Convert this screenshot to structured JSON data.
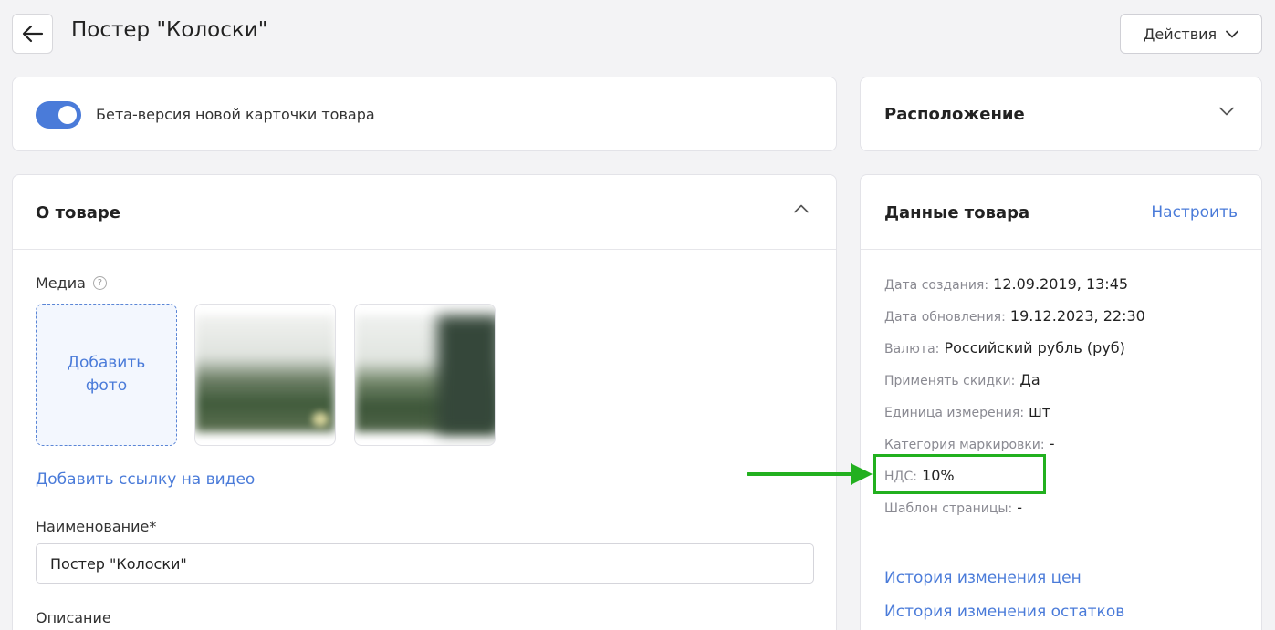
{
  "header": {
    "title": "Постер \"Колоски\"",
    "actions_label": "Действия"
  },
  "beta": {
    "label": "Бета-версия новой карточки товара",
    "enabled": true
  },
  "location": {
    "title": "Расположение"
  },
  "about": {
    "title": "О товаре",
    "media_label": "Медиа",
    "add_photo_label": "Добавить фото",
    "add_video_label": "Добавить ссылку на видео",
    "name_label": "Наименование",
    "name_required_mark": "*",
    "name_value": "Постер \"Колоски\"",
    "description_label": "Описание"
  },
  "product_data": {
    "title": "Данные товара",
    "configure_label": "Настроить",
    "rows": [
      {
        "key": "Дата создания:",
        "value": "12.09.2019, 13:45"
      },
      {
        "key": "Дата обновления:",
        "value": "19.12.2023, 22:30"
      },
      {
        "key": "Валюта:",
        "value": "Российский рубль (руб)"
      },
      {
        "key": "Применять скидки:",
        "value": "Да"
      },
      {
        "key": "Единица измерения:",
        "value": "шт"
      },
      {
        "key": "Категория маркировки:",
        "value": "-"
      },
      {
        "key": "НДС:",
        "value": "10%"
      },
      {
        "key": "Шаблон страницы:",
        "value": "-"
      }
    ],
    "price_history_label": "История изменения цен",
    "stock_history_label": "История изменения остатков"
  },
  "colors": {
    "accent": "#4a7bd9",
    "annotation": "#22b01f"
  }
}
